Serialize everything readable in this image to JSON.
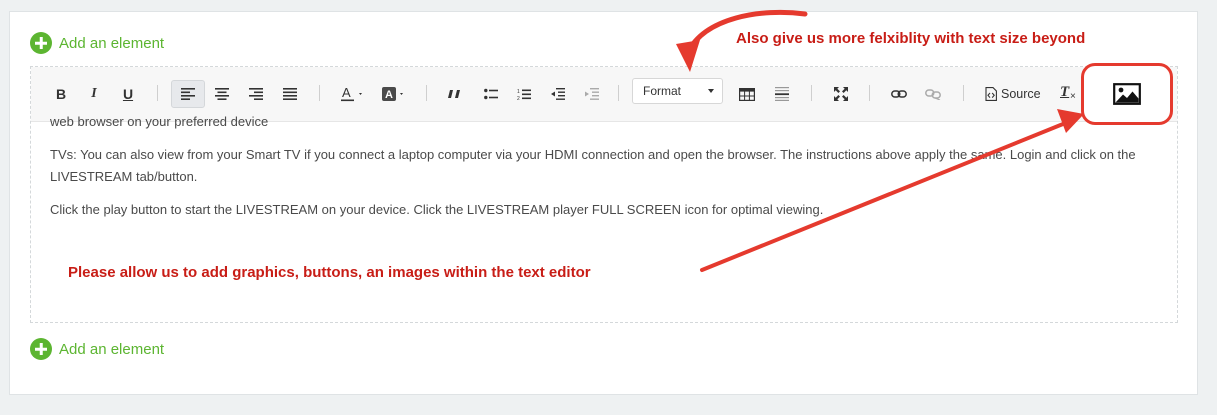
{
  "add_element_top": "Add an element",
  "add_element_bottom": "Add an element",
  "toolbar": {
    "bold": "B",
    "italic": "I",
    "underline": "U",
    "format_label": "Format",
    "source_label": "Source",
    "clear_format": "T"
  },
  "content": {
    "clipped_line": "web browser on your preferred device",
    "paragraph_1": "TVs:  You can also view from your Smart TV if you connect a laptop computer via your HDMI connection and open the browser. The instructions above apply the same. Login and click on the LIVESTREAM tab/button.",
    "paragraph_2": "Click the play button to start the LIVESTREAM on your device. Click the LIVESTREAM player FULL SCREEN icon for optimal viewing."
  },
  "annotations": {
    "top_note": "Also give us more felxiblity with text size beyond",
    "bottom_note": "Please allow us to add graphics, buttons, an images within the text editor"
  },
  "colors": {
    "accent_green": "#5cb531",
    "annotation_red": "#c81d16",
    "arrow_red": "#e53a2e"
  }
}
